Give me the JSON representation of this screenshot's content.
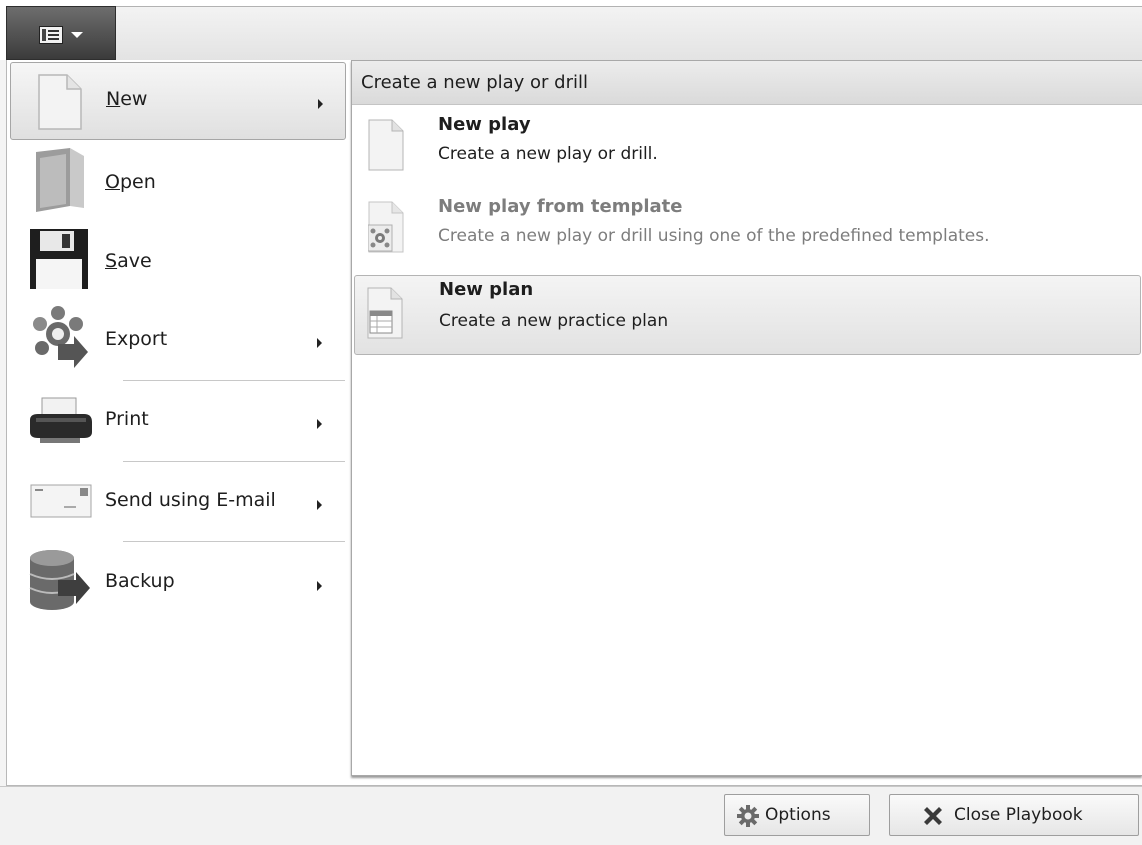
{
  "app_menu": {
    "icon": "document-list-icon",
    "dropdown_icon": "chevron-down-icon"
  },
  "nav": {
    "items": [
      {
        "label": "New",
        "mnemonic": "N",
        "rest": "ew",
        "icon": "new-document-icon",
        "has_submenu": true,
        "selected": true
      },
      {
        "label": "Open",
        "mnemonic": "O",
        "rest": "pen",
        "icon": "folder-icon",
        "has_submenu": false
      },
      {
        "label": "Save",
        "mnemonic": "S",
        "rest": "ave",
        "icon": "floppy-disk-icon",
        "has_submenu": false
      },
      {
        "label": "Export",
        "icon": "export-icon",
        "has_submenu": true
      },
      {
        "label": "Print",
        "icon": "printer-icon",
        "has_submenu": true
      },
      {
        "label": "Send using E-mail",
        "icon": "envelope-icon",
        "has_submenu": true
      },
      {
        "label": "Backup",
        "icon": "database-backup-icon",
        "has_submenu": true
      }
    ]
  },
  "submenu": {
    "header": "Create a new play or drill",
    "items": [
      {
        "title": "New play",
        "description": "Create a new play or drill.",
        "icon": "new-document-icon",
        "enabled": true
      },
      {
        "title": "New play from template",
        "description": "Create a new play or drill using one of the predefined templates.",
        "icon": "template-document-icon",
        "enabled": false
      },
      {
        "title": "New plan",
        "description": "Create a new practice plan",
        "icon": "plan-document-icon",
        "enabled": true,
        "highlighted": true
      }
    ]
  },
  "footer": {
    "options_label": "Options",
    "options_icon": "gear-icon",
    "close_label": "Close Playbook",
    "close_icon": "close-x-icon"
  }
}
